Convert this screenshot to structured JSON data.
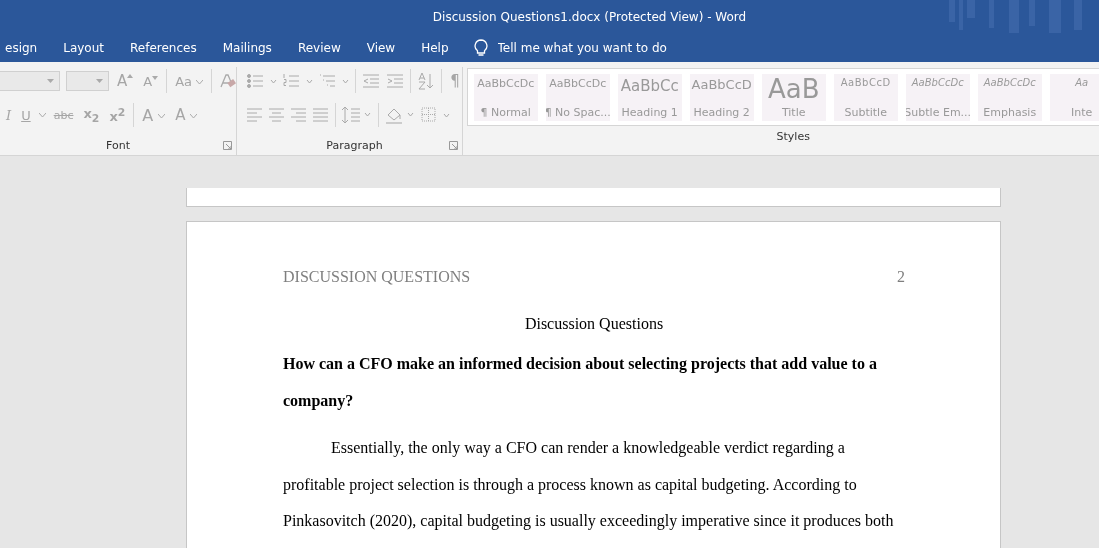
{
  "window": {
    "title": "Discussion Questions1.docx (Protected View)  -  Word"
  },
  "tabs": [
    {
      "label": "esign",
      "selected": false
    },
    {
      "label": "Layout",
      "selected": false
    },
    {
      "label": "References",
      "selected": false
    },
    {
      "label": "Mailings",
      "selected": false
    },
    {
      "label": "Review",
      "selected": false
    },
    {
      "label": "View",
      "selected": false
    },
    {
      "label": "Help",
      "selected": false
    }
  ],
  "tell_me": {
    "placeholder": "Tell me what you want to do"
  },
  "ribbon": {
    "disabled": true,
    "font": {
      "label": "Font",
      "grow": "A",
      "shrink": "A",
      "change_case": "Aa",
      "italic": "I",
      "underline": "U",
      "strikethrough": "abc",
      "subscript": "x$_{2}$",
      "superscript": "x$^{2}$",
      "effects": "A",
      "font_color": "A"
    },
    "paragraph": {
      "label": "Paragraph",
      "show_marks": "¶"
    },
    "styles": {
      "label": "Styles",
      "items": [
        {
          "kind": "normal",
          "preview": "AaBbCcDc",
          "label": "¶ Normal"
        },
        {
          "kind": "normal",
          "preview": "AaBbCcDc",
          "label": "¶ No Spac..."
        },
        {
          "kind": "heading1",
          "preview": "AaBbCc",
          "label": "Heading 1"
        },
        {
          "kind": "heading2",
          "preview": "AaBbCcD",
          "label": "Heading 2"
        },
        {
          "kind": "title",
          "preview": "AaB",
          "label": "Title"
        },
        {
          "kind": "subtitle",
          "preview": "AaBbCcD",
          "label": "Subtitle"
        },
        {
          "kind": "subtle",
          "preview": "AaBbCcDc",
          "label": "Subtle Em..."
        },
        {
          "kind": "emphasis",
          "preview": "AaBbCcDc",
          "label": "Emphasis"
        },
        {
          "kind": "subtle",
          "preview": "Aa",
          "label": "Inte"
        }
      ]
    }
  },
  "document": {
    "header": "DISCUSSION QUESTIONS",
    "page_number": "2",
    "title": "Discussion Questions",
    "question": "How can a CFO make an informed decision about selecting projects that add value to a company?",
    "paragraph": "Essentially, the only way a CFO can render a knowledgeable verdict regarding a profitable project selection is through a process known as capital budgeting. According to Pinkasovitch (2020), capital budgeting is usually exceedingly imperative since it produces both"
  }
}
